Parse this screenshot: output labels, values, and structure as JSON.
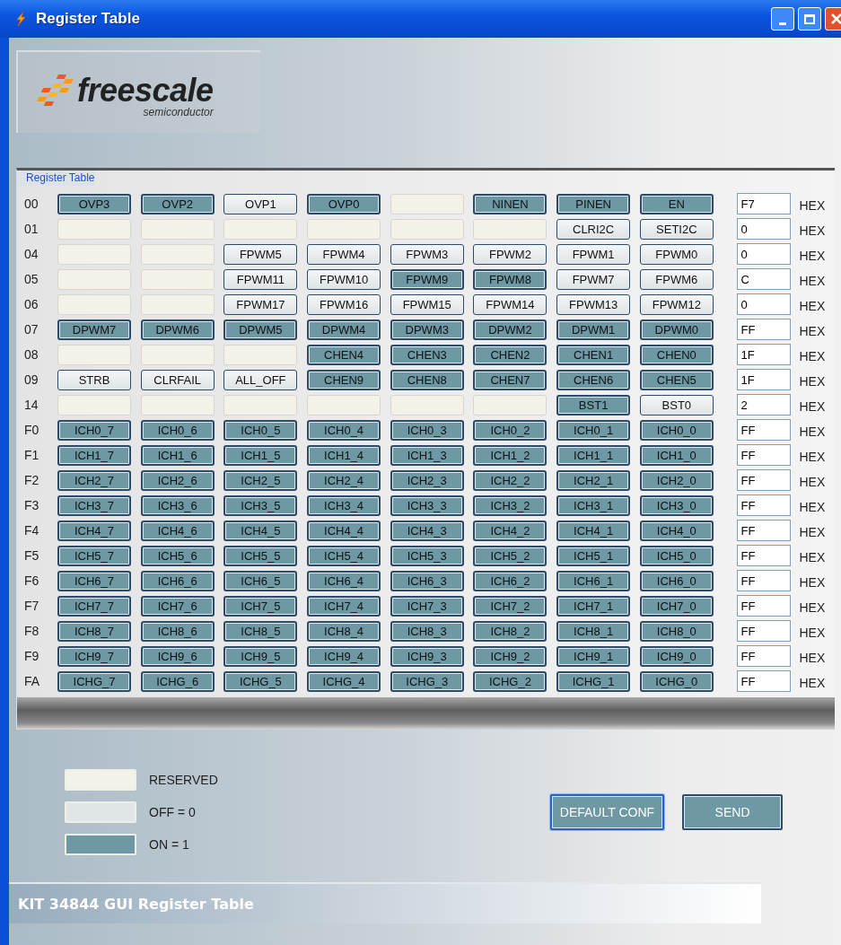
{
  "window": {
    "title": "Register Table"
  },
  "logo": {
    "name": "freescale",
    "tagline": "semiconductor"
  },
  "register_table": {
    "title": "Register Table",
    "rows": [
      {
        "address": "00",
        "value": "F7",
        "unit": "HEX",
        "bits": [
          {
            "kind": "bit",
            "label": "OVP3",
            "on": true
          },
          {
            "kind": "bit",
            "label": "OVP2",
            "on": true
          },
          {
            "kind": "bit",
            "label": "OVP1",
            "on": false
          },
          {
            "kind": "bit",
            "label": "OVP0",
            "on": true
          },
          {
            "kind": "reserved"
          },
          {
            "kind": "bit",
            "label": "NINEN",
            "on": true
          },
          {
            "kind": "bit",
            "label": "PINEN",
            "on": true
          },
          {
            "kind": "bit",
            "label": "EN",
            "on": true
          }
        ]
      },
      {
        "address": "01",
        "value": "0",
        "unit": "HEX",
        "bits": [
          {
            "kind": "reserved"
          },
          {
            "kind": "reserved"
          },
          {
            "kind": "reserved"
          },
          {
            "kind": "reserved"
          },
          {
            "kind": "reserved"
          },
          {
            "kind": "reserved"
          },
          {
            "kind": "bit",
            "label": "CLRI2C",
            "on": false
          },
          {
            "kind": "bit",
            "label": "SETI2C",
            "on": false
          }
        ]
      },
      {
        "address": "04",
        "value": "0",
        "unit": "HEX",
        "bits": [
          {
            "kind": "reserved"
          },
          {
            "kind": "reserved"
          },
          {
            "kind": "bit",
            "label": "FPWM5",
            "on": false
          },
          {
            "kind": "bit",
            "label": "FPWM4",
            "on": false
          },
          {
            "kind": "bit",
            "label": "FPWM3",
            "on": false
          },
          {
            "kind": "bit",
            "label": "FPWM2",
            "on": false
          },
          {
            "kind": "bit",
            "label": "FPWM1",
            "on": false
          },
          {
            "kind": "bit",
            "label": "FPWM0",
            "on": false
          }
        ]
      },
      {
        "address": "05",
        "value": "C",
        "unit": "HEX",
        "bits": [
          {
            "kind": "reserved"
          },
          {
            "kind": "reserved"
          },
          {
            "kind": "bit",
            "label": "FPWM11",
            "on": false
          },
          {
            "kind": "bit",
            "label": "FPWM10",
            "on": false
          },
          {
            "kind": "bit",
            "label": "FPWM9",
            "on": true
          },
          {
            "kind": "bit",
            "label": "FPWM8",
            "on": true
          },
          {
            "kind": "bit",
            "label": "FPWM7",
            "on": false
          },
          {
            "kind": "bit",
            "label": "FPWM6",
            "on": false
          }
        ]
      },
      {
        "address": "06",
        "value": "0",
        "unit": "HEX",
        "bits": [
          {
            "kind": "reserved"
          },
          {
            "kind": "reserved"
          },
          {
            "kind": "bit",
            "label": "FPWM17",
            "on": false
          },
          {
            "kind": "bit",
            "label": "FPWM16",
            "on": false
          },
          {
            "kind": "bit",
            "label": "FPWM15",
            "on": false
          },
          {
            "kind": "bit",
            "label": "FPWM14",
            "on": false
          },
          {
            "kind": "bit",
            "label": "FPWM13",
            "on": false
          },
          {
            "kind": "bit",
            "label": "FPWM12",
            "on": false
          }
        ]
      },
      {
        "address": "07",
        "value": "FF",
        "unit": "HEX",
        "bits": [
          {
            "kind": "bit",
            "label": "DPWM7",
            "on": true
          },
          {
            "kind": "bit",
            "label": "DPWM6",
            "on": true
          },
          {
            "kind": "bit",
            "label": "DPWM5",
            "on": true
          },
          {
            "kind": "bit",
            "label": "DPWM4",
            "on": true
          },
          {
            "kind": "bit",
            "label": "DPWM3",
            "on": true
          },
          {
            "kind": "bit",
            "label": "DPWM2",
            "on": true
          },
          {
            "kind": "bit",
            "label": "DPWM1",
            "on": true
          },
          {
            "kind": "bit",
            "label": "DPWM0",
            "on": true
          }
        ]
      },
      {
        "address": "08",
        "value": "1F",
        "unit": "HEX",
        "bits": [
          {
            "kind": "reserved"
          },
          {
            "kind": "reserved"
          },
          {
            "kind": "reserved"
          },
          {
            "kind": "bit",
            "label": "CHEN4",
            "on": true
          },
          {
            "kind": "bit",
            "label": "CHEN3",
            "on": true
          },
          {
            "kind": "bit",
            "label": "CHEN2",
            "on": true
          },
          {
            "kind": "bit",
            "label": "CHEN1",
            "on": true
          },
          {
            "kind": "bit",
            "label": "CHEN0",
            "on": true
          }
        ]
      },
      {
        "address": "09",
        "value": "1F",
        "unit": "HEX",
        "bits": [
          {
            "kind": "bit",
            "label": "STRB",
            "on": false
          },
          {
            "kind": "bit",
            "label": "CLRFAIL",
            "on": false
          },
          {
            "kind": "bit",
            "label": "ALL_OFF",
            "on": false
          },
          {
            "kind": "bit",
            "label": "CHEN9",
            "on": true
          },
          {
            "kind": "bit",
            "label": "CHEN8",
            "on": true
          },
          {
            "kind": "bit",
            "label": "CHEN7",
            "on": true
          },
          {
            "kind": "bit",
            "label": "CHEN6",
            "on": true
          },
          {
            "kind": "bit",
            "label": "CHEN5",
            "on": true
          }
        ]
      },
      {
        "address": "14",
        "value": "2",
        "unit": "HEX",
        "bits": [
          {
            "kind": "reserved"
          },
          {
            "kind": "reserved"
          },
          {
            "kind": "reserved"
          },
          {
            "kind": "reserved"
          },
          {
            "kind": "reserved"
          },
          {
            "kind": "reserved"
          },
          {
            "kind": "bit",
            "label": "BST1",
            "on": true
          },
          {
            "kind": "bit",
            "label": "BST0",
            "on": false
          }
        ]
      },
      {
        "address": "F0",
        "value": "FF",
        "unit": "HEX",
        "bits": [
          {
            "kind": "bit",
            "label": "ICH0_7",
            "on": true
          },
          {
            "kind": "bit",
            "label": "ICH0_6",
            "on": true
          },
          {
            "kind": "bit",
            "label": "ICH0_5",
            "on": true
          },
          {
            "kind": "bit",
            "label": "ICH0_4",
            "on": true
          },
          {
            "kind": "bit",
            "label": "ICH0_3",
            "on": true
          },
          {
            "kind": "bit",
            "label": "ICH0_2",
            "on": true
          },
          {
            "kind": "bit",
            "label": "ICH0_1",
            "on": true
          },
          {
            "kind": "bit",
            "label": "ICH0_0",
            "on": true
          }
        ]
      },
      {
        "address": "F1",
        "value": "FF",
        "unit": "HEX",
        "bits": [
          {
            "kind": "bit",
            "label": "ICH1_7",
            "on": true
          },
          {
            "kind": "bit",
            "label": "ICH1_6",
            "on": true
          },
          {
            "kind": "bit",
            "label": "ICH1_5",
            "on": true
          },
          {
            "kind": "bit",
            "label": "ICH1_4",
            "on": true
          },
          {
            "kind": "bit",
            "label": "ICH1_3",
            "on": true
          },
          {
            "kind": "bit",
            "label": "ICH1_2",
            "on": true
          },
          {
            "kind": "bit",
            "label": "ICH1_1",
            "on": true
          },
          {
            "kind": "bit",
            "label": "ICH1_0",
            "on": true
          }
        ]
      },
      {
        "address": "F2",
        "value": "FF",
        "unit": "HEX",
        "bits": [
          {
            "kind": "bit",
            "label": "ICH2_7",
            "on": true
          },
          {
            "kind": "bit",
            "label": "ICH2_6",
            "on": true
          },
          {
            "kind": "bit",
            "label": "ICH2_5",
            "on": true
          },
          {
            "kind": "bit",
            "label": "ICH2_4",
            "on": true
          },
          {
            "kind": "bit",
            "label": "ICH2_3",
            "on": true
          },
          {
            "kind": "bit",
            "label": "ICH2_2",
            "on": true
          },
          {
            "kind": "bit",
            "label": "ICH2_1",
            "on": true
          },
          {
            "kind": "bit",
            "label": "ICH2_0",
            "on": true
          }
        ]
      },
      {
        "address": "F3",
        "value": "FF",
        "unit": "HEX",
        "bits": [
          {
            "kind": "bit",
            "label": "ICH3_7",
            "on": true
          },
          {
            "kind": "bit",
            "label": "ICH3_6",
            "on": true
          },
          {
            "kind": "bit",
            "label": "ICH3_5",
            "on": true
          },
          {
            "kind": "bit",
            "label": "ICH3_4",
            "on": true
          },
          {
            "kind": "bit",
            "label": "ICH3_3",
            "on": true
          },
          {
            "kind": "bit",
            "label": "ICH3_2",
            "on": true
          },
          {
            "kind": "bit",
            "label": "ICH3_1",
            "on": true
          },
          {
            "kind": "bit",
            "label": "ICH3_0",
            "on": true
          }
        ]
      },
      {
        "address": "F4",
        "value": "FF",
        "unit": "HEX",
        "bits": [
          {
            "kind": "bit",
            "label": "ICH4_7",
            "on": true
          },
          {
            "kind": "bit",
            "label": "ICH4_6",
            "on": true
          },
          {
            "kind": "bit",
            "label": "ICH4_5",
            "on": true
          },
          {
            "kind": "bit",
            "label": "ICH4_4",
            "on": true
          },
          {
            "kind": "bit",
            "label": "ICH4_3",
            "on": true
          },
          {
            "kind": "bit",
            "label": "ICH4_2",
            "on": true
          },
          {
            "kind": "bit",
            "label": "ICH4_1",
            "on": true
          },
          {
            "kind": "bit",
            "label": "ICH4_0",
            "on": true
          }
        ]
      },
      {
        "address": "F5",
        "value": "FF",
        "unit": "HEX",
        "bits": [
          {
            "kind": "bit",
            "label": "ICH5_7",
            "on": true
          },
          {
            "kind": "bit",
            "label": "ICH5_6",
            "on": true
          },
          {
            "kind": "bit",
            "label": "ICH5_5",
            "on": true
          },
          {
            "kind": "bit",
            "label": "ICH5_4",
            "on": true
          },
          {
            "kind": "bit",
            "label": "ICH5_3",
            "on": true
          },
          {
            "kind": "bit",
            "label": "ICH5_2",
            "on": true
          },
          {
            "kind": "bit",
            "label": "ICH5_1",
            "on": true
          },
          {
            "kind": "bit",
            "label": "ICH5_0",
            "on": true
          }
        ]
      },
      {
        "address": "F6",
        "value": "FF",
        "unit": "HEX",
        "bits": [
          {
            "kind": "bit",
            "label": "ICH6_7",
            "on": true
          },
          {
            "kind": "bit",
            "label": "ICH6_6",
            "on": true
          },
          {
            "kind": "bit",
            "label": "ICH6_5",
            "on": true
          },
          {
            "kind": "bit",
            "label": "ICH6_4",
            "on": true
          },
          {
            "kind": "bit",
            "label": "ICH6_3",
            "on": true
          },
          {
            "kind": "bit",
            "label": "ICH6_2",
            "on": true
          },
          {
            "kind": "bit",
            "label": "ICH6_1",
            "on": true
          },
          {
            "kind": "bit",
            "label": "ICH6_0",
            "on": true
          }
        ]
      },
      {
        "address": "F7",
        "value": "FF",
        "unit": "HEX",
        "bits": [
          {
            "kind": "bit",
            "label": "ICH7_7",
            "on": true
          },
          {
            "kind": "bit",
            "label": "ICH7_6",
            "on": true
          },
          {
            "kind": "bit",
            "label": "ICH7_5",
            "on": true
          },
          {
            "kind": "bit",
            "label": "ICH7_4",
            "on": true
          },
          {
            "kind": "bit",
            "label": "ICH7_3",
            "on": true
          },
          {
            "kind": "bit",
            "label": "ICH7_2",
            "on": true
          },
          {
            "kind": "bit",
            "label": "ICH7_1",
            "on": true
          },
          {
            "kind": "bit",
            "label": "ICH7_0",
            "on": true
          }
        ]
      },
      {
        "address": "F8",
        "value": "FF",
        "unit": "HEX",
        "bits": [
          {
            "kind": "bit",
            "label": "ICH8_7",
            "on": true
          },
          {
            "kind": "bit",
            "label": "ICH8_6",
            "on": true
          },
          {
            "kind": "bit",
            "label": "ICH8_5",
            "on": true
          },
          {
            "kind": "bit",
            "label": "ICH8_4",
            "on": true
          },
          {
            "kind": "bit",
            "label": "ICH8_3",
            "on": true
          },
          {
            "kind": "bit",
            "label": "ICH8_2",
            "on": true
          },
          {
            "kind": "bit",
            "label": "ICH8_1",
            "on": true
          },
          {
            "kind": "bit",
            "label": "ICH8_0",
            "on": true
          }
        ]
      },
      {
        "address": "F9",
        "value": "FF",
        "unit": "HEX",
        "bits": [
          {
            "kind": "bit",
            "label": "ICH9_7",
            "on": true
          },
          {
            "kind": "bit",
            "label": "ICH9_6",
            "on": true
          },
          {
            "kind": "bit",
            "label": "ICH9_5",
            "on": true
          },
          {
            "kind": "bit",
            "label": "ICH9_4",
            "on": true
          },
          {
            "kind": "bit",
            "label": "ICH9_3",
            "on": true
          },
          {
            "kind": "bit",
            "label": "ICH9_2",
            "on": true
          },
          {
            "kind": "bit",
            "label": "ICH9_1",
            "on": true
          },
          {
            "kind": "bit",
            "label": "ICH9_0",
            "on": true
          }
        ]
      },
      {
        "address": "FA",
        "value": "FF",
        "unit": "HEX",
        "bits": [
          {
            "kind": "bit",
            "label": "ICHG_7",
            "on": true
          },
          {
            "kind": "bit",
            "label": "ICHG_6",
            "on": true
          },
          {
            "kind": "bit",
            "label": "ICHG_5",
            "on": true
          },
          {
            "kind": "bit",
            "label": "ICHG_4",
            "on": true
          },
          {
            "kind": "bit",
            "label": "ICHG_3",
            "on": true
          },
          {
            "kind": "bit",
            "label": "ICHG_2",
            "on": true
          },
          {
            "kind": "bit",
            "label": "ICHG_1",
            "on": true
          },
          {
            "kind": "bit",
            "label": "ICHG_0",
            "on": true
          }
        ]
      }
    ]
  },
  "legend": [
    {
      "kind": "reserved",
      "label": "RESERVED"
    },
    {
      "kind": "off",
      "label": "OFF = 0"
    },
    {
      "kind": "on",
      "label": "ON = 1"
    }
  ],
  "buttons": [
    {
      "label": "DEFAULT CONF",
      "focused": true
    },
    {
      "label": "SEND",
      "focused": false
    }
  ],
  "status_bar": {
    "text": "KIT 34844 GUI Register Table"
  }
}
